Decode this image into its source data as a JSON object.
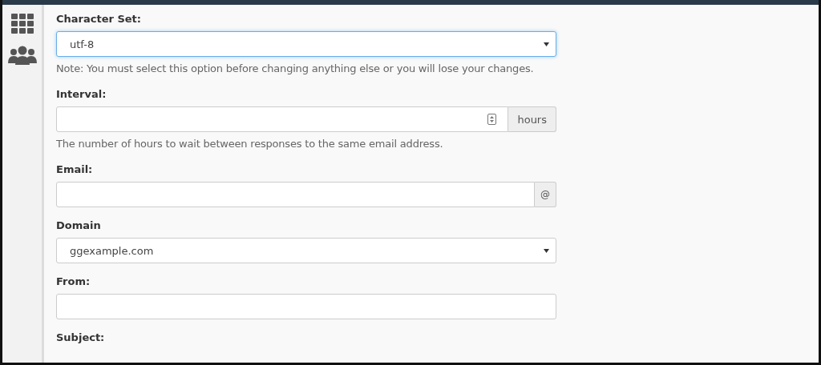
{
  "sidebar": {
    "items": [
      {
        "kind": "grid"
      },
      {
        "kind": "users"
      }
    ]
  },
  "fields": [
    {
      "kind": "select",
      "label": "Character Set:",
      "value": "utf-8",
      "focused": true,
      "help": "Note: You must select this option before changing anything else or you will lose your changes."
    },
    {
      "kind": "number",
      "label": "Interval:",
      "addon": "hours",
      "help": "The number of hours to wait between responses to the same email address."
    },
    {
      "kind": "addon-text",
      "label": "Email:",
      "addon": "@"
    },
    {
      "kind": "select",
      "label": "Domain",
      "value": "ggexample.com",
      "focused": false
    },
    {
      "kind": "text",
      "label": "From:"
    },
    {
      "kind": "label-only",
      "label": "Subject:"
    }
  ]
}
